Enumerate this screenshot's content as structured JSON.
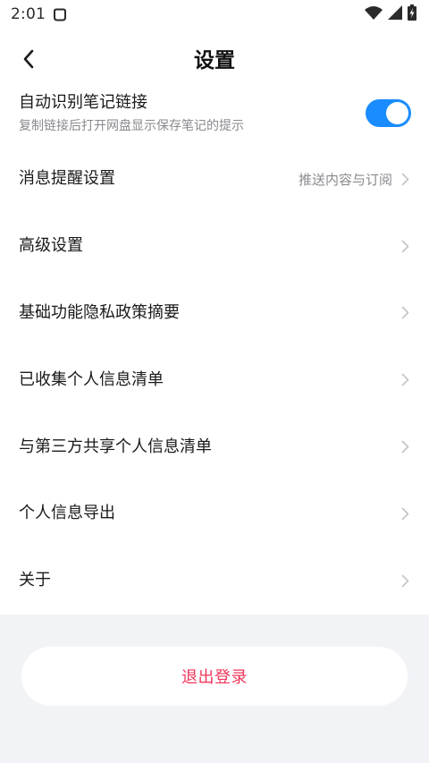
{
  "status_bar": {
    "time": "2:01",
    "left_icon": "notification-icon",
    "right_icons": [
      "wifi-icon",
      "cell-signal-icon",
      "battery-charging-icon"
    ]
  },
  "header": {
    "back_icon": "chevron-left-icon",
    "title": "设置"
  },
  "settings": {
    "auto_link": {
      "label": "自动识别笔记链接",
      "description": "复制链接后打开网盘显示保存笔记的提示",
      "enabled": true
    },
    "items": [
      {
        "label": "消息提醒设置",
        "value": "推送内容与订阅"
      },
      {
        "label": "高级设置",
        "value": ""
      },
      {
        "label": "基础功能隐私政策摘要",
        "value": ""
      },
      {
        "label": "已收集个人信息清单",
        "value": ""
      },
      {
        "label": "与第三方共享个人信息清单",
        "value": ""
      },
      {
        "label": "个人信息导出",
        "value": ""
      },
      {
        "label": "关于",
        "value": ""
      }
    ]
  },
  "footer": {
    "logout_label": "退出登录"
  },
  "colors": {
    "accent": "#1a8cff",
    "danger": "#f0365b",
    "footer_bg": "#f2f3f7"
  }
}
